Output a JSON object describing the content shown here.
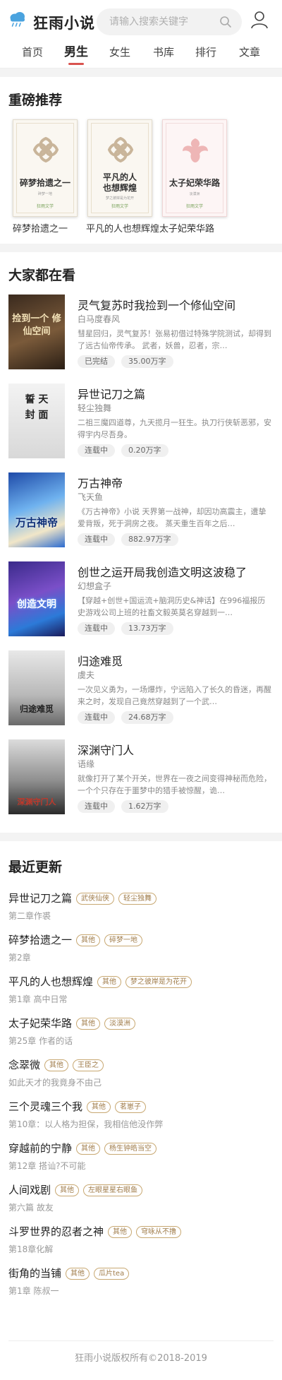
{
  "header": {
    "brand": "狂雨小说",
    "search_placeholder": "请输入搜索关键字",
    "logo_icon": "cloud-rain-icon",
    "search_icon": "search-icon",
    "user_icon": "user-icon"
  },
  "nav": {
    "items": [
      "首页",
      "男生",
      "女生",
      "书库",
      "排行",
      "文章"
    ],
    "active": "男生",
    "accent": "#d9534f"
  },
  "featured": {
    "title": "重磅推荐",
    "books": [
      {
        "name": "碎梦拾遗之一",
        "cover_title": "碎梦拾遗之一",
        "cover_author": "碎梦一地",
        "cover_pub": "狂雨文学"
      },
      {
        "name": "平凡的人也想辉煌",
        "cover_title": "平凡的人\n也想辉煌",
        "cover_author": "梦之彼岸是为花开",
        "cover_pub": "狂雨文学"
      },
      {
        "name": "太子妃荣华路",
        "cover_title": "太子妃荣华路",
        "cover_author": "淡漠洲",
        "cover_pub": "狂雨文学"
      }
    ]
  },
  "popular": {
    "title": "大家都在看",
    "books": [
      {
        "title": "灵气复苏时我捡到一个修仙空间",
        "author": "白马度春风",
        "desc": "彗星回归，灵气复苏！张易初借过特殊学院测试，却得到了远古仙帝传承。 武者，妖兽，忍者，宗…",
        "status": "已完结",
        "words": "35.00万字",
        "cover_text": "捡到一个 修仙空间"
      },
      {
        "title": "异世记刀之篇",
        "author": "轻尘独舞",
        "desc": "二祖三魔四道尊，九天揽月一狂生。执刀行侠斩恶邪，安得宇内尽吾身。",
        "status": "连载中",
        "words": "0.20万字",
        "cover_text": "誓 天 封 面"
      },
      {
        "title": "万古神帝",
        "author": "飞天鱼",
        "desc": "《万古神帝》小说 天界第一战神，却因功高震主，遭挚爱背叛，死于洞房之夜。 蒸天重生百年之后…",
        "status": "连载中",
        "words": "882.97万字",
        "cover_text": "万古神帝"
      },
      {
        "title": "创世之运开局我创造文明这波稳了",
        "author": "幻想盒子",
        "desc": "【穿越+创世+国运流+脑洞历史&神话】在996福报历史游戏公司上班的社畜文毅英莫名穿越到一…",
        "status": "连载中",
        "words": "13.73万字",
        "cover_text": "创造文明"
      },
      {
        "title": "归途难觅",
        "author": "虞夫",
        "desc": "一次见义勇为，一场爆炸，宁远陷入了长久的昏迷，再醒来之时，发现自己竟然穿越到了一个武…",
        "status": "连载中",
        "words": "24.68万字",
        "cover_text": "归途难觅"
      },
      {
        "title": "深渊守门人",
        "author": "语缘",
        "desc": "就像打开了某个开关，世界在一夜之间变得神秘而危险，一个个只存在于噩梦中的猎手被惊醒，诡…",
        "status": "连载中",
        "words": "1.62万字",
        "cover_text": "深渊守门人"
      }
    ]
  },
  "recent": {
    "title": "最近更新",
    "items": [
      {
        "title": "异世记刀之篇",
        "tags": [
          "武侠仙侠",
          "轻尘独舞"
        ],
        "chapter": "第二章作裘"
      },
      {
        "title": "碎梦拾遗之一",
        "tags": [
          "其他",
          "碎梦一地"
        ],
        "chapter": "第2章"
      },
      {
        "title": "平凡的人也想辉煌",
        "tags": [
          "其他",
          "梦之彼岸是为花开"
        ],
        "chapter": "第1章 高中日常"
      },
      {
        "title": "太子妃荣华路",
        "tags": [
          "其他",
          "淡漠洲"
        ],
        "chapter": "第25章 作者的话"
      },
      {
        "title": "念翠微",
        "tags": [
          "其他",
          "王臣之"
        ],
        "chapter": "如此天才的我竟身不由己"
      },
      {
        "title": "三个灵魂三个我",
        "tags": [
          "其他",
          "茗崽子"
        ],
        "chapter": "第10章：以人格为担保，我相信他没作弊"
      },
      {
        "title": "穿越前的宁静",
        "tags": [
          "其他",
          "杨生钟皓当空"
        ],
        "chapter": "第12章 搭讪?不可能"
      },
      {
        "title": "人间戏剧",
        "tags": [
          "其他",
          "左眼星星右眼鱼"
        ],
        "chapter": "第六篇 故友"
      },
      {
        "title": "斗罗世界的忍者之神",
        "tags": [
          "其他",
          "穹咏从不撸"
        ],
        "chapter": "第18章化解"
      },
      {
        "title": "街角的当铺",
        "tags": [
          "其他",
          "瓜片tea"
        ],
        "chapter": "第1章 陈叔一"
      }
    ]
  },
  "footer": {
    "copyright": "狂雨小说版权所有©2018-2019"
  }
}
